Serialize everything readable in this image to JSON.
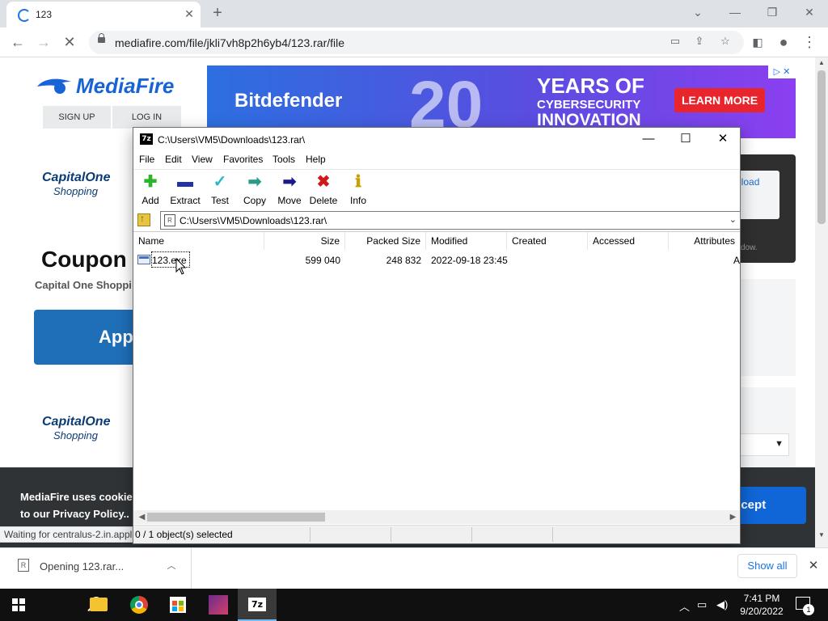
{
  "browser": {
    "tab_title": "123",
    "url": "mediafire.com/file/jkli7vh8p2h6yb4/123.rar/file",
    "win_controls": {
      "chevron": "⌄",
      "minimize": "—",
      "restore": "❐",
      "close": "✕"
    }
  },
  "page": {
    "logo": "MediaFire",
    "sign_up": "SIGN UP",
    "log_in": "LOG IN",
    "ad": {
      "brand": "Bitdefender",
      "big_number": "20",
      "line1": "YEARS OF",
      "line2": "CYBERSECURITY",
      "line3": "INNOVATION",
      "cta": "LEARN MORE",
      "adchoices": "▷ ✕"
    },
    "capital_one_1": {
      "name": "CapitalOne",
      "sub": "Shopping"
    },
    "capital_one_2": {
      "name": "CapitalOne",
      "sub": "Shopping"
    },
    "coupon_title": "Coupon c",
    "coupon_sub": "Capital One Shoppi",
    "app_button": "App",
    "download_partial": "nload",
    "window_note": "dow.",
    "cookie_line1": "MediaFire uses cookies",
    "cookie_line2": "to our Privacy Policy..",
    "accept": "ccept",
    "status_text": "Waiting for centralus-2.in.appl"
  },
  "download_shelf": {
    "item_label": "Opening 123.rar...",
    "show_all": "Show all"
  },
  "taskbar": {
    "time": "7:41 PM",
    "date": "9/20/2022",
    "notifications": "1"
  },
  "sevenzip": {
    "title": "C:\\Users\\VM5\\Downloads\\123.rar\\",
    "menu": [
      "File",
      "Edit",
      "View",
      "Favorites",
      "Tools",
      "Help"
    ],
    "tools": [
      {
        "label": "Add",
        "icon": "add-icon",
        "glyph": "✚",
        "color": "#2bb52b"
      },
      {
        "label": "Extract",
        "icon": "extract-icon",
        "glyph": "▬",
        "color": "#2233aa"
      },
      {
        "label": "Test",
        "icon": "test-icon",
        "glyph": "✓",
        "color": "#28b8c8"
      },
      {
        "label": "Copy",
        "icon": "copy-icon",
        "glyph": "➡",
        "color": "#2a9a8a"
      },
      {
        "label": "Move",
        "icon": "move-icon",
        "glyph": "➡",
        "color": "#1a1a8a"
      },
      {
        "label": "Delete",
        "icon": "delete-icon",
        "glyph": "✖",
        "color": "#d01818"
      },
      {
        "label": "Info",
        "icon": "info-icon",
        "glyph": "ℹ",
        "color": "#c8a000"
      }
    ],
    "address": "C:\\Users\\VM5\\Downloads\\123.rar\\",
    "columns": [
      "Name",
      "Size",
      "Packed Size",
      "Modified",
      "Created",
      "Accessed",
      "Attributes"
    ],
    "rows": [
      {
        "name": "123.exe",
        "size": "599 040",
        "packed_size": "248 832",
        "modified": "2022-09-18 23:45",
        "created": "",
        "accessed": "",
        "attributes": "A"
      }
    ],
    "status": "0 / 1 object(s) selected"
  }
}
